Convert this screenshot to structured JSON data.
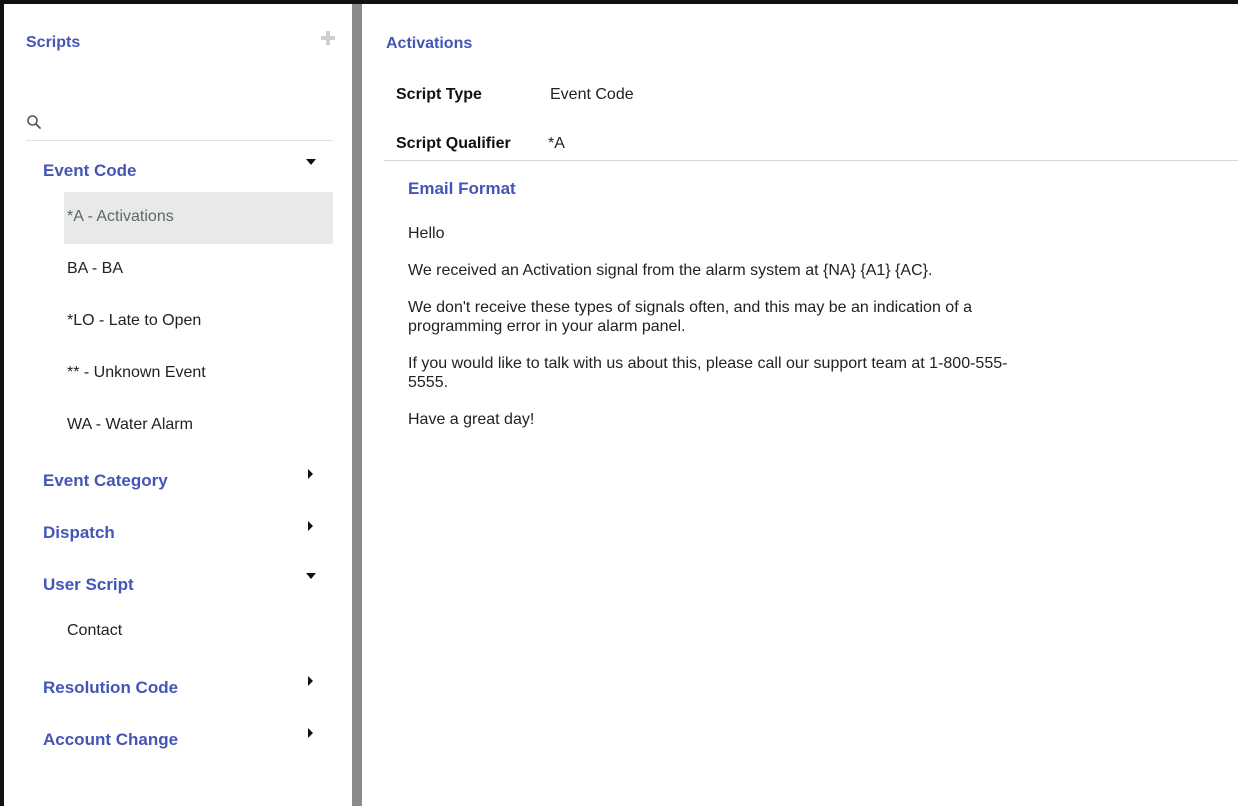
{
  "sidebar": {
    "title": "Scripts",
    "search": {
      "placeholder": "",
      "value": ""
    },
    "groups": [
      {
        "label": "Event Code",
        "expanded": true,
        "items": [
          {
            "label": "*A - Activations",
            "selected": true
          },
          {
            "label": "BA - BA"
          },
          {
            "label": "*LO - Late to Open"
          },
          {
            "label": "** - Unknown Event"
          },
          {
            "label": "WA - Water Alarm"
          }
        ]
      },
      {
        "label": "Event Category",
        "expanded": false
      },
      {
        "label": "Dispatch",
        "expanded": false
      },
      {
        "label": "User Script",
        "expanded": true,
        "items": [
          {
            "label": "Contact"
          }
        ]
      },
      {
        "label": "Resolution Code",
        "expanded": false
      },
      {
        "label": "Account Change",
        "expanded": false
      }
    ]
  },
  "main": {
    "title": "Activations",
    "script_type": {
      "label": "Script Type",
      "value": "Event Code"
    },
    "script_qualifier": {
      "label": "Script Qualifier",
      "value": "*A"
    },
    "email_format": {
      "title": "Email Format",
      "paragraphs": [
        "Hello",
        "We received an Activation signal from the alarm system at {NA} {A1} {AC}.",
        "We don't receive these types of signals often, and this may be an indication of a",
        "programming error in your alarm panel.",
        "If you would like to talk with us about this, please call our support team at 1-800-555-",
        "5555.",
        "Have a great day!"
      ]
    }
  },
  "colors": {
    "accent": "#4455b8",
    "selected_bg": "#e9e9e9",
    "splitter": "#8a8a8a"
  },
  "icons": {
    "add": "plus-icon",
    "search": "search-icon",
    "expanded": "caret-down-icon",
    "collapsed": "caret-right-icon"
  }
}
